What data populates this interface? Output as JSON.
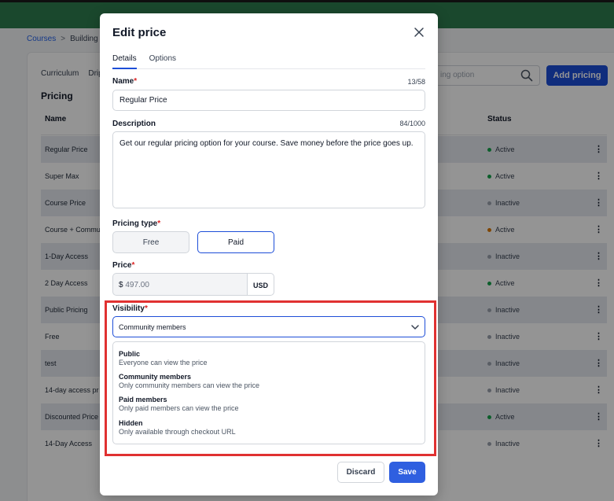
{
  "background": {
    "breadcrumb": {
      "courses": "Courses",
      "current": "Building a"
    },
    "tabs": [
      "Curriculum",
      "Drip"
    ],
    "section_title": "Pricing",
    "search_placeholder": "ing option",
    "add_pricing_label": "Add pricing",
    "columns": {
      "name": "Name",
      "status": "Status"
    },
    "rows": [
      {
        "name": "Regular Price",
        "status": "Active",
        "status_color": "#16a34a"
      },
      {
        "name": "Super Max",
        "status": "Active",
        "status_color": "#16a34a"
      },
      {
        "name": "Course Price",
        "status": "Inactive",
        "status_color": "#9ca3af"
      },
      {
        "name": "Course + Commu",
        "status": "Active",
        "status_color": "#d97706"
      },
      {
        "name": "1-Day Access",
        "status": "Inactive",
        "status_color": "#9ca3af"
      },
      {
        "name": "2 Day Access",
        "status": "Active",
        "status_color": "#16a34a"
      },
      {
        "name": "Public Pricing",
        "status": "Inactive",
        "status_color": "#9ca3af"
      },
      {
        "name": "Free",
        "status": "Inactive",
        "status_color": "#9ca3af"
      },
      {
        "name": "test",
        "status": "Inactive",
        "status_color": "#9ca3af"
      },
      {
        "name": "14-day access pr",
        "status": "Inactive",
        "status_color": "#9ca3af"
      },
      {
        "name": "Discounted Price",
        "status": "Active",
        "status_color": "#16a34a"
      },
      {
        "name": "14-Day Access",
        "status": "Inactive",
        "status_color": "#9ca3af"
      }
    ],
    "kebab_glyph": "⋮"
  },
  "modal": {
    "title": "Edit price",
    "tabs": {
      "details": "Details",
      "options": "Options"
    },
    "name": {
      "label": "Name",
      "required_mark": "*",
      "value": "Regular Price",
      "counter": "13/58"
    },
    "description": {
      "label": "Description",
      "value": "Get our regular pricing option for your course. Save money before the price goes up.",
      "counter": "84/1000"
    },
    "pricing_type": {
      "label": "Pricing type",
      "required_mark": "*",
      "free_label": "Free",
      "paid_label": "Paid",
      "selected": "Paid"
    },
    "price": {
      "label": "Price",
      "required_mark": "*",
      "currency_sign": "$",
      "value": "497.00",
      "currency": "USD"
    },
    "visibility": {
      "label": "Visibility",
      "required_mark": "*",
      "selected": "Community members",
      "options": [
        {
          "title": "Public",
          "description": "Everyone can view the price"
        },
        {
          "title": "Community members",
          "description": "Only community members can view the price"
        },
        {
          "title": "Paid members",
          "description": "Only paid members can view the price"
        },
        {
          "title": "Hidden",
          "description": "Only available through checkout URL"
        }
      ]
    },
    "discard_label": "Discard",
    "save_label": "Save"
  },
  "colors": {
    "accent": "#1d4ed8",
    "save_button": "#2f5fe0",
    "highlight_box": "#e03131",
    "topbar": "#2e7d4f"
  },
  "icons": {
    "close": "close-icon",
    "search": "search-icon",
    "chevron": "chevron-down-icon",
    "kebab": "kebab-icon"
  }
}
